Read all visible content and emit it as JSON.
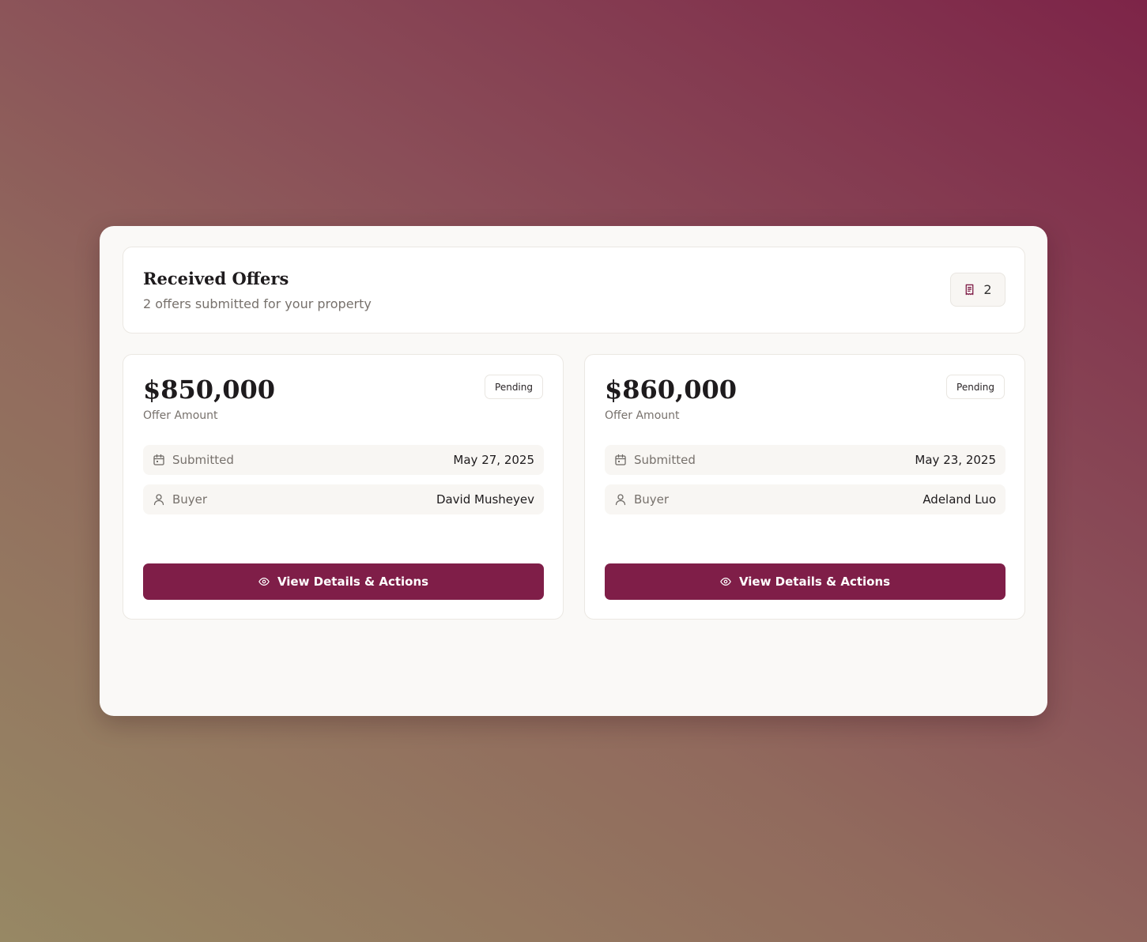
{
  "header": {
    "title": "Received Offers",
    "subtitle": "2 offers submitted for your property",
    "count": "2",
    "count_icon": "receipt-icon"
  },
  "colors": {
    "accent": "#7f1e48",
    "panel": "#faf9f7",
    "row_background": "#f8f6f3"
  },
  "offers": [
    {
      "amount": "$850,000",
      "amount_label": "Offer Amount",
      "status": "Pending",
      "submitted_label": "Submitted",
      "submitted_date": "May 27, 2025",
      "buyer_label": "Buyer",
      "buyer_name": "David Musheyev",
      "action_label": "View Details & Actions"
    },
    {
      "amount": "$860,000",
      "amount_label": "Offer Amount",
      "status": "Pending",
      "submitted_label": "Submitted",
      "submitted_date": "May 23, 2025",
      "buyer_label": "Buyer",
      "buyer_name": "Adeland Luo",
      "action_label": "View Details & Actions"
    }
  ]
}
